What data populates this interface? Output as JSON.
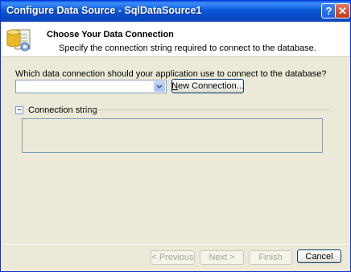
{
  "window": {
    "title": "Configure Data Source - SqlDataSource1"
  },
  "titlebar_buttons": {
    "help": "?",
    "close": "✕"
  },
  "header": {
    "title": "Choose Your Data Connection",
    "description": "Specify the connection string required to connect to the database."
  },
  "connection": {
    "question": "Which data connection should your application use to connect to the database?",
    "selected_value": "",
    "new_connection_label": "New Connection...",
    "new_connection_accesskey": "N",
    "new_connection_rest": "ew Connection..."
  },
  "connection_string": {
    "label": "Connection string",
    "value": ""
  },
  "footer": {
    "previous_label": "< Previous",
    "next_label": "Next >",
    "finish_label": "Finish",
    "cancel_label": "Cancel"
  },
  "colors": {
    "titlebar": "#0a5fe6",
    "dialog_bg": "#ece9d8",
    "header_bg": "#ffffff",
    "button_border": "#003c74"
  },
  "icons": [
    "database-wizard-icon",
    "help-icon",
    "close-icon",
    "chevron-down-icon",
    "collapse-icon"
  ]
}
